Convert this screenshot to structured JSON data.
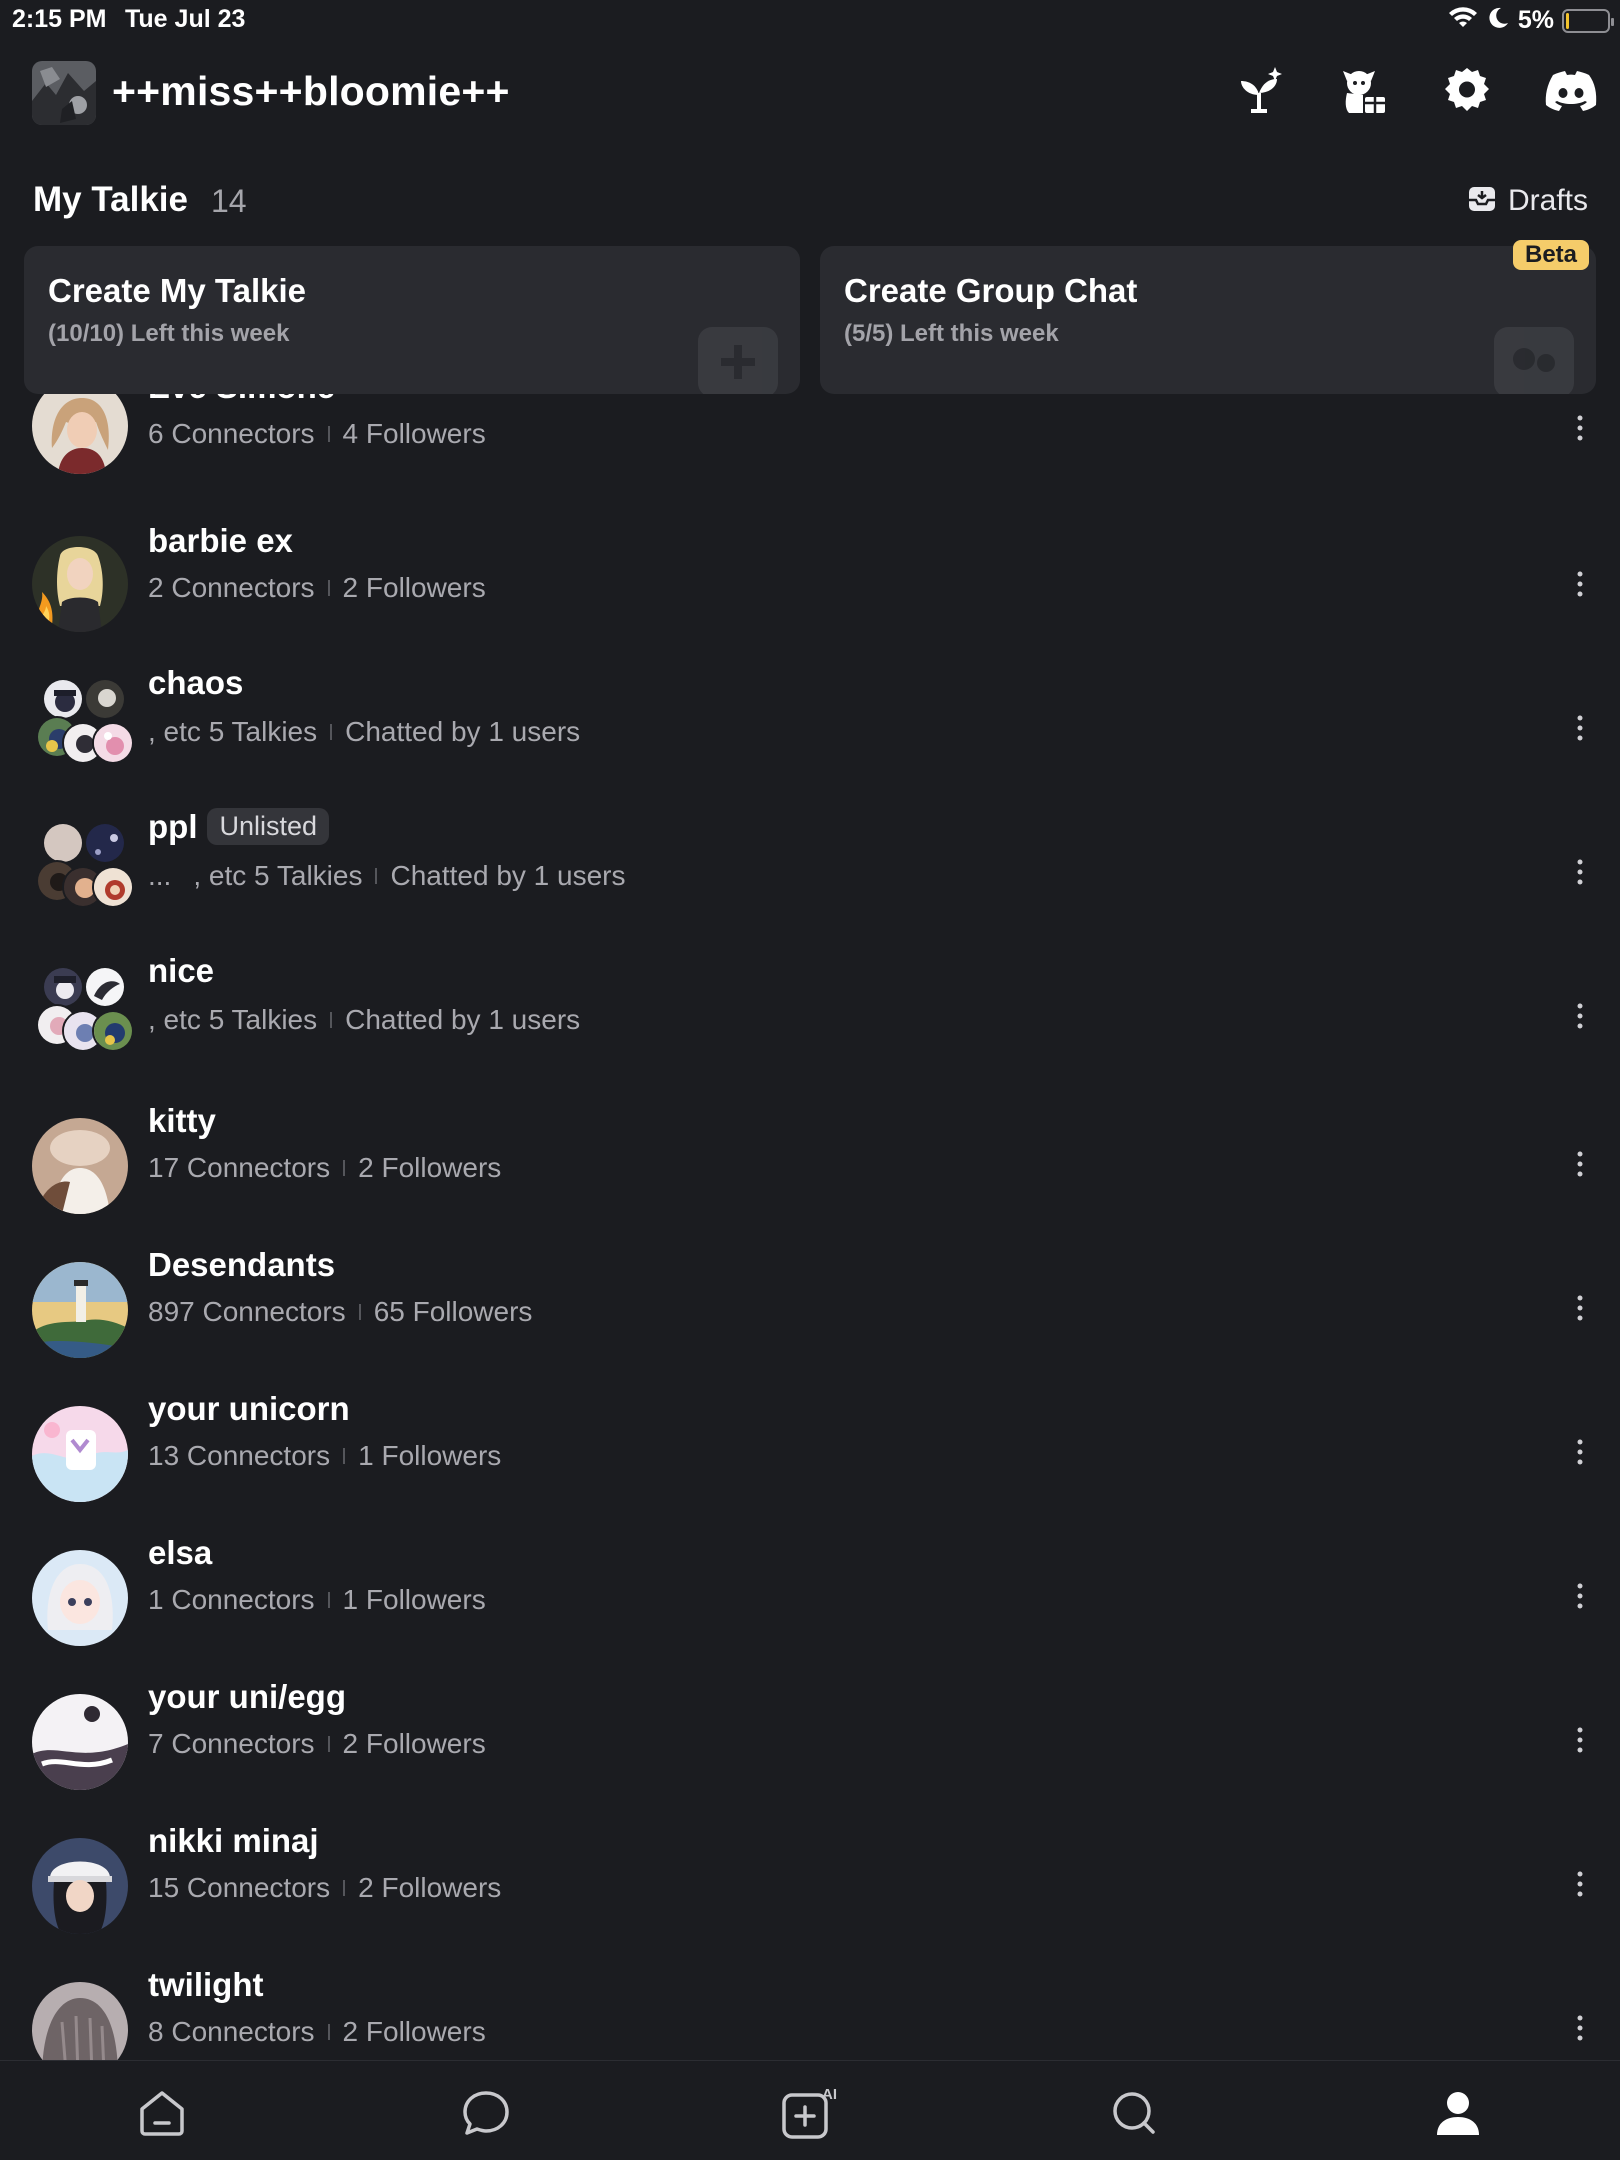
{
  "status_bar": {
    "time": "2:15 PM",
    "date": "Tue Jul 23",
    "battery": "5%"
  },
  "header": {
    "title": "++miss++bloomie++",
    "actions": [
      "sparkle-plant-icon",
      "character-gift-icon",
      "gear-icon",
      "discord-icon"
    ]
  },
  "section": {
    "title": "My Talkie",
    "count": "14",
    "drafts_label": "Drafts"
  },
  "create_cards": {
    "talkie": {
      "title": "Create My Talkie",
      "sub": "(10/10) Left this week"
    },
    "group": {
      "title": "Create Group Chat",
      "sub": "(5/5) Left this week",
      "badge": "Beta"
    }
  },
  "talkies": [
    {
      "name": "Eve Simone",
      "a": "6 Connectors",
      "b": "4 Followers"
    },
    {
      "name": "barbie ex",
      "a": "2 Connectors",
      "b": "2 Followers"
    },
    {
      "name": "chaos",
      "a": ", etc 5 Talkies",
      "b": "Chatted by 1 users"
    },
    {
      "name": "ppl",
      "badge": "Unlisted",
      "prefix": "...",
      "a": ", etc 5 Talkies",
      "b": "Chatted by 1 users"
    },
    {
      "name": "nice",
      "a": ", etc 5 Talkies",
      "b": "Chatted by 1 users"
    },
    {
      "name": "kitty",
      "a": "17 Connectors",
      "b": "2 Followers"
    },
    {
      "name": "Desendants",
      "a": "897 Connectors",
      "b": "65 Followers"
    },
    {
      "name": "your unicorn",
      "a": "13 Connectors",
      "b": "1 Followers"
    },
    {
      "name": "elsa",
      "a": "1 Connectors",
      "b": "1 Followers"
    },
    {
      "name": "your uni/egg",
      "a": "7 Connectors",
      "b": "2 Followers"
    },
    {
      "name": "nikki minaj",
      "a": "15 Connectors",
      "b": "2 Followers"
    },
    {
      "name": "twilight",
      "a": "8 Connectors",
      "b": "2 Followers"
    }
  ],
  "tab_bar": {
    "tabs": [
      "home-icon",
      "chat-bubble-icon",
      "create-ai-icon",
      "search-icon",
      "profile-icon"
    ],
    "ai_badge": "AI"
  },
  "colors": {
    "background": "#1b1c20",
    "card": "#2a2b30",
    "beta": "#f5cc6a",
    "muted_text": "#a9a9af"
  }
}
